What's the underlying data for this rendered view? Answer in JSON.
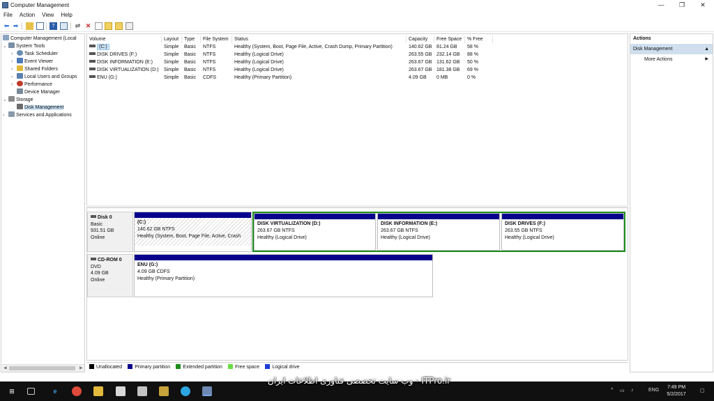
{
  "window": {
    "title": "Computer Management"
  },
  "menu": [
    "File",
    "Action",
    "View",
    "Help"
  ],
  "tree": {
    "root": "Computer Management (Local",
    "items": [
      {
        "label": "System Tools",
        "indent": 0
      },
      {
        "label": "Task Scheduler",
        "indent": 1
      },
      {
        "label": "Event Viewer",
        "indent": 1
      },
      {
        "label": "Shared Folders",
        "indent": 1
      },
      {
        "label": "Local Users and Groups",
        "indent": 1
      },
      {
        "label": "Performance",
        "indent": 1
      },
      {
        "label": "Device Manager",
        "indent": 1
      },
      {
        "label": "Storage",
        "indent": 0
      },
      {
        "label": "Disk Management",
        "indent": 1
      },
      {
        "label": "Services and Applications",
        "indent": 0
      }
    ]
  },
  "volumes": {
    "columns": [
      "Volume",
      "Layout",
      "Type",
      "File System",
      "Status",
      "Capacity",
      "Free Space",
      "% Free"
    ],
    "rows": [
      [
        "(C:)",
        "Simple",
        "Basic",
        "NTFS",
        "Healthy (System, Boot, Page File, Active, Crash Dump, Primary Partition)",
        "140.62 GB",
        "81.24 GB",
        "58 %"
      ],
      [
        "DISK DRIVES (F:)",
        "Simple",
        "Basic",
        "NTFS",
        "Healthy (Logical Drive)",
        "263.55 GB",
        "232.14 GB",
        "88 %"
      ],
      [
        "DISK INFORMATION (E:)",
        "Simple",
        "Basic",
        "NTFS",
        "Healthy (Logical Drive)",
        "263.67 GB",
        "131.62 GB",
        "50 %"
      ],
      [
        "DISK VIRTUALIZATION (D:)",
        "Simple",
        "Basic",
        "NTFS",
        "Healthy (Logical Drive)",
        "263.67 GB",
        "181.38 GB",
        "69 %"
      ],
      [
        "ENU (G:)",
        "Simple",
        "Basic",
        "CDFS",
        "Healthy (Primary Partition)",
        "4.09 GB",
        "0 MB",
        "0 %"
      ]
    ]
  },
  "disks": [
    {
      "name": "Disk 0",
      "type": "Basic",
      "size": "931.51 GB",
      "status": "Online",
      "partitions": [
        {
          "name": "(C:)",
          "size": "140.62 GB NTFS",
          "status": "Healthy (System, Boot, Page File, Active, Crash"
        },
        {
          "name": "DISK VIRTUALIZATION  (D:)",
          "size": "263.67 GB NTFS",
          "status": "Healthy (Logical Drive)"
        },
        {
          "name": "DISK INFORMATION  (E:)",
          "size": "263.67 GB NTFS",
          "status": "Healthy (Logical Drive)"
        },
        {
          "name": "DISK DRIVES  (F:)",
          "size": "263.55 GB NTFS",
          "status": "Healthy (Logical Drive)"
        }
      ]
    },
    {
      "name": "CD-ROM 0",
      "type": "DVD",
      "size": "4.09 GB",
      "status": "Online",
      "partitions": [
        {
          "name": "ENU  (G:)",
          "size": "4.09 GB CDFS",
          "status": "Healthy (Primary Partition)"
        }
      ]
    }
  ],
  "legend": [
    {
      "label": "Unallocated",
      "color": "#000000"
    },
    {
      "label": "Primary partition",
      "color": "#08008c"
    },
    {
      "label": "Extended partition",
      "color": "#1c8c1c"
    },
    {
      "label": "Free space",
      "color": "#66dd44"
    },
    {
      "label": "Logical drive",
      "color": "#1a3bd6"
    }
  ],
  "actions": {
    "header": "Actions",
    "section": "Disk Management",
    "items": [
      "More Actions"
    ]
  },
  "taskbar": {
    "watermark": "وب سایت تخصصی فناوری اطلاعات ایران - ITPro.ir",
    "lang": "ENG",
    "time": "7:49 PM",
    "date": "5/2/2017"
  }
}
